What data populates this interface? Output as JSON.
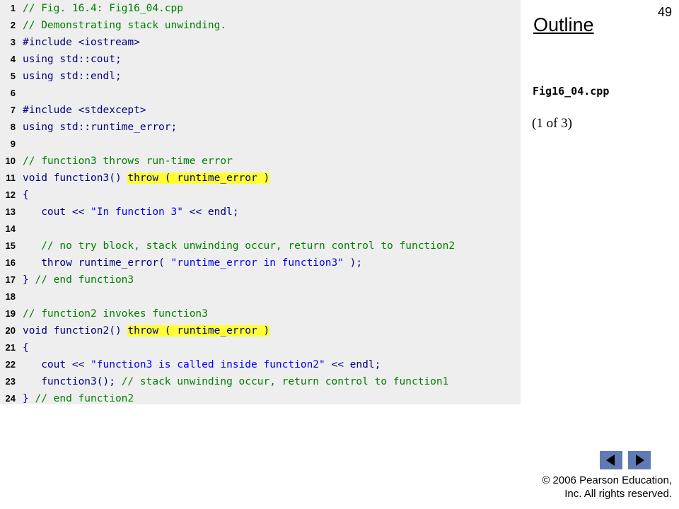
{
  "slide": {
    "page_number": "49",
    "outline_title": "Outline",
    "file_name": "Fig16_04.cpp",
    "part_label": "(1 of 3)",
    "copyright_line1": "© 2006 Pearson Education,",
    "copyright_line2": "Inc.  All rights reserved."
  },
  "nav": {
    "prev_icon": "triangle-left-icon",
    "next_icon": "triangle-right-icon",
    "button_color": "#5f7ab5"
  },
  "colors": {
    "comment": "#008000",
    "keyword": "#000080",
    "string": "#0000ff",
    "highlight": "#ffff33",
    "panel": "#eeeeee"
  },
  "code": [
    {
      "num": "1",
      "tokens": [
        {
          "t": "c",
          "v": "// Fig. 16.4: Fig16_04.cpp"
        }
      ]
    },
    {
      "num": "2",
      "tokens": [
        {
          "t": "c",
          "v": "// Demonstrating stack unwinding."
        }
      ]
    },
    {
      "num": "3",
      "tokens": [
        {
          "t": "k",
          "v": "#include <iostream>"
        }
      ]
    },
    {
      "num": "4",
      "tokens": [
        {
          "t": "k",
          "v": "using std::cout;"
        }
      ]
    },
    {
      "num": "5",
      "tokens": [
        {
          "t": "k",
          "v": "using std::endl;"
        }
      ]
    },
    {
      "num": "6",
      "tokens": []
    },
    {
      "num": "7",
      "tokens": [
        {
          "t": "k",
          "v": "#include <stdexcept>"
        }
      ]
    },
    {
      "num": "8",
      "tokens": [
        {
          "t": "k",
          "v": "using std::runtime_error;"
        }
      ]
    },
    {
      "num": "9",
      "tokens": []
    },
    {
      "num": "10",
      "tokens": [
        {
          "t": "c",
          "v": "// function3 throws run-time error"
        }
      ]
    },
    {
      "num": "11",
      "tokens": [
        {
          "t": "k",
          "v": "void function3() "
        },
        {
          "t": "hl",
          "v": "throw ( runtime_error )"
        }
      ]
    },
    {
      "num": "12",
      "tokens": [
        {
          "t": "k",
          "v": "{"
        }
      ]
    },
    {
      "num": "13",
      "tokens": [
        {
          "t": "k",
          "v": "   cout << "
        },
        {
          "t": "s",
          "v": "\"In function 3\""
        },
        {
          "t": "k",
          "v": " << endl;"
        }
      ]
    },
    {
      "num": "14",
      "tokens": []
    },
    {
      "num": "15",
      "tokens": [
        {
          "t": "c",
          "v": "   // no try block, stack unwinding occur, return control to function2"
        }
      ]
    },
    {
      "num": "16",
      "tokens": [
        {
          "t": "k",
          "v": "   throw runtime_error( "
        },
        {
          "t": "s",
          "v": "\"runtime_error in function3\""
        },
        {
          "t": "k",
          "v": " );"
        }
      ]
    },
    {
      "num": "17",
      "tokens": [
        {
          "t": "k",
          "v": "} "
        },
        {
          "t": "c",
          "v": "// end function3"
        }
      ]
    },
    {
      "num": "18",
      "tokens": []
    },
    {
      "num": "19",
      "tokens": [
        {
          "t": "c",
          "v": "// function2 invokes function3"
        }
      ]
    },
    {
      "num": "20",
      "tokens": [
        {
          "t": "k",
          "v": "void function2() "
        },
        {
          "t": "hl",
          "v": "throw ( runtime_error )"
        }
      ]
    },
    {
      "num": "21",
      "tokens": [
        {
          "t": "k",
          "v": "{"
        }
      ]
    },
    {
      "num": "22",
      "tokens": [
        {
          "t": "k",
          "v": "   cout << "
        },
        {
          "t": "s",
          "v": "\"function3 is called inside function2\""
        },
        {
          "t": "k",
          "v": " << endl;"
        }
      ]
    },
    {
      "num": "23",
      "tokens": [
        {
          "t": "k",
          "v": "   function3(); "
        },
        {
          "t": "c",
          "v": "// stack unwinding occur, return control to function1"
        }
      ]
    },
    {
      "num": "24",
      "tokens": [
        {
          "t": "k",
          "v": "} "
        },
        {
          "t": "c",
          "v": "// end function2"
        }
      ]
    }
  ]
}
